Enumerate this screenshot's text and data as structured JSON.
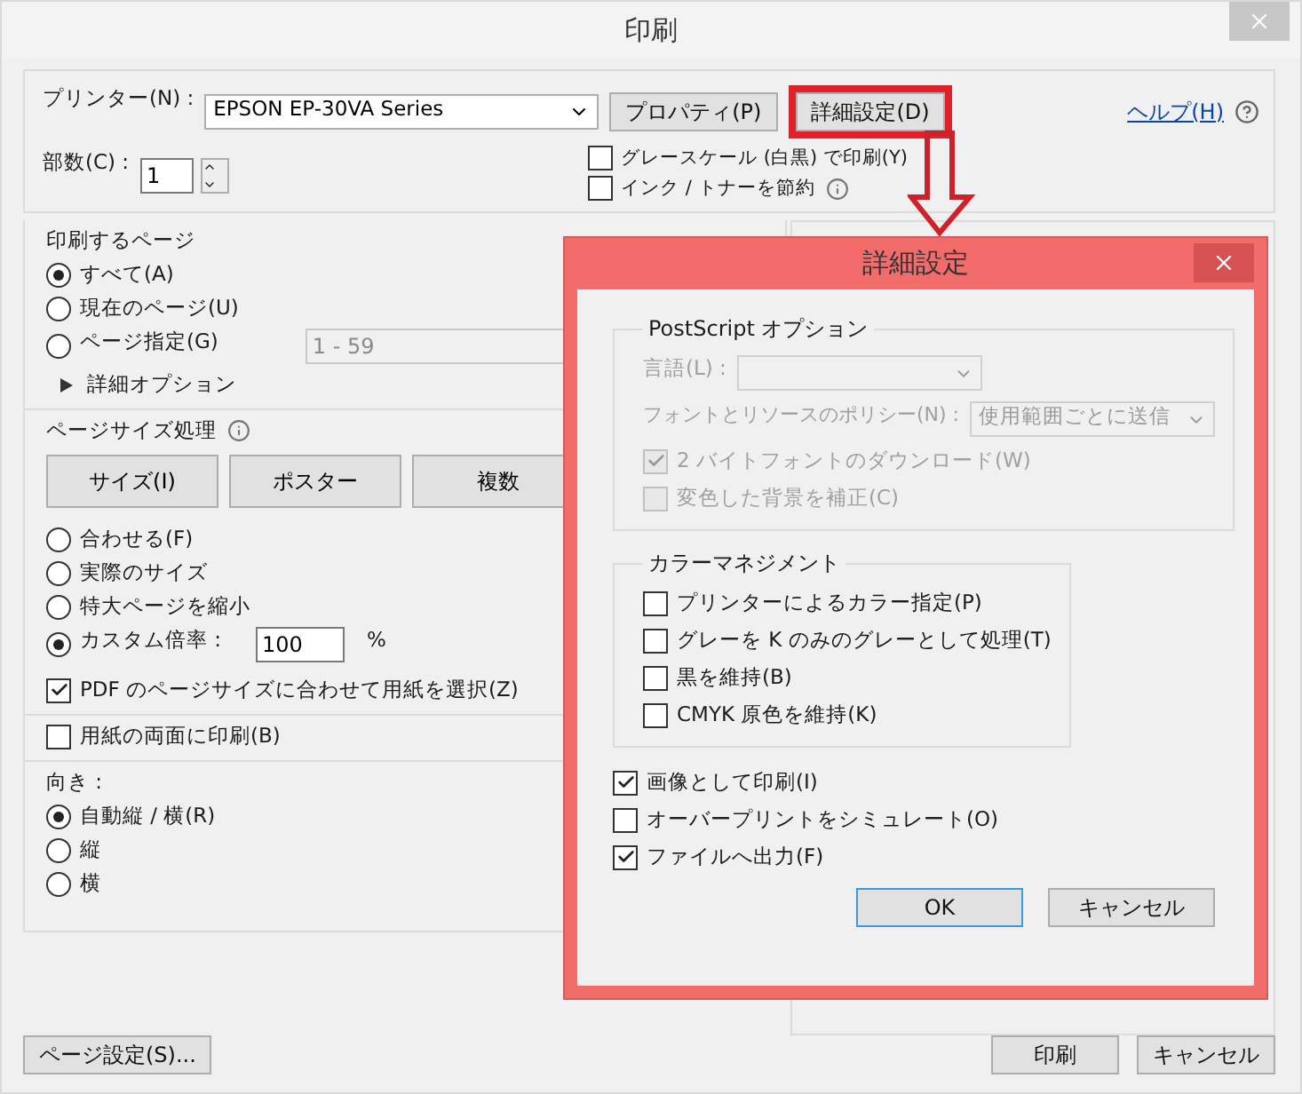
{
  "window": {
    "title": "印刷"
  },
  "printer": {
    "label": "プリンター(N) :",
    "value": "EPSON EP-30VA Series",
    "properties_button": "プロパティ(P)",
    "advanced_button": {
      "label": "詳細設定(D)",
      "highlighted": true
    }
  },
  "help_link": "ヘルプ(H)",
  "copies": {
    "label": "部数(C) :",
    "value": "1"
  },
  "print_options": [
    {
      "label": "グレースケール (白黒) で印刷(Y)",
      "checked": false,
      "info": false
    },
    {
      "label": "インク / トナーを節約",
      "checked": false,
      "info": true
    }
  ],
  "pages_to_print": {
    "title": "印刷するページ",
    "choices": [
      {
        "label": "すべて(A)",
        "selected": true
      },
      {
        "label": "現在のページ(U)",
        "selected": false
      },
      {
        "label": "ページ指定(G)",
        "selected": false,
        "range": "1 - 59"
      }
    ],
    "more_options": "詳細オプション"
  },
  "page_sizing": {
    "title": "ページサイズ処理",
    "modes": [
      "サイズ(I)",
      "ポスター",
      "複数"
    ],
    "choices": [
      {
        "label": "合わせる(F)",
        "selected": false
      },
      {
        "label": "実際のサイズ",
        "selected": false
      },
      {
        "label": "特大ページを縮小",
        "selected": false
      },
      {
        "label": "カスタム倍率 :",
        "selected": true,
        "value": "100",
        "unit": "%"
      }
    ],
    "choose_paper": {
      "label": "PDF のページサイズに合わせて用紙を選択(Z)",
      "checked": true
    }
  },
  "duplex": {
    "label": "用紙の両面に印刷(B)",
    "checked": false
  },
  "orientation": {
    "title": "向き :",
    "choices": [
      {
        "label": "自動縦 / 横(R)",
        "selected": true
      },
      {
        "label": "縦",
        "selected": false
      },
      {
        "label": "横",
        "selected": false
      }
    ]
  },
  "page_setup_button": "ページ設定(S)...",
  "print_button": "印刷",
  "cancel_button": "キャンセル",
  "advanced_dialog": {
    "title": "詳細設定",
    "postscript": {
      "title": "PostScript オプション",
      "disabled": true,
      "language_label": "言語(L) :",
      "policy_label": "フォントとリソースのポリシー(N) :",
      "policy_value": "使用範囲ごとに送信",
      "options": [
        {
          "label": "2 バイトフォントのダウンロード(W)",
          "checked": true
        },
        {
          "label": "変色した背景を補正(C)",
          "checked": false
        }
      ]
    },
    "color": {
      "title": "カラーマネジメント",
      "options": [
        {
          "label": "プリンターによるカラー指定(P)",
          "checked": false
        },
        {
          "label": "グレーを K のみのグレーとして処理(T)",
          "checked": false
        },
        {
          "label": "黒を維持(B)",
          "checked": false
        },
        {
          "label": "CMYK 原色を維持(K)",
          "checked": false
        }
      ]
    },
    "options": [
      {
        "label": "画像として印刷(I)",
        "checked": true
      },
      {
        "label": "オーバープリントをシミュレート(O)",
        "checked": false
      },
      {
        "label": "ファイルへ出力(F)",
        "checked": true
      }
    ],
    "ok_button": "OK",
    "cancel_button": "キャンセル"
  }
}
